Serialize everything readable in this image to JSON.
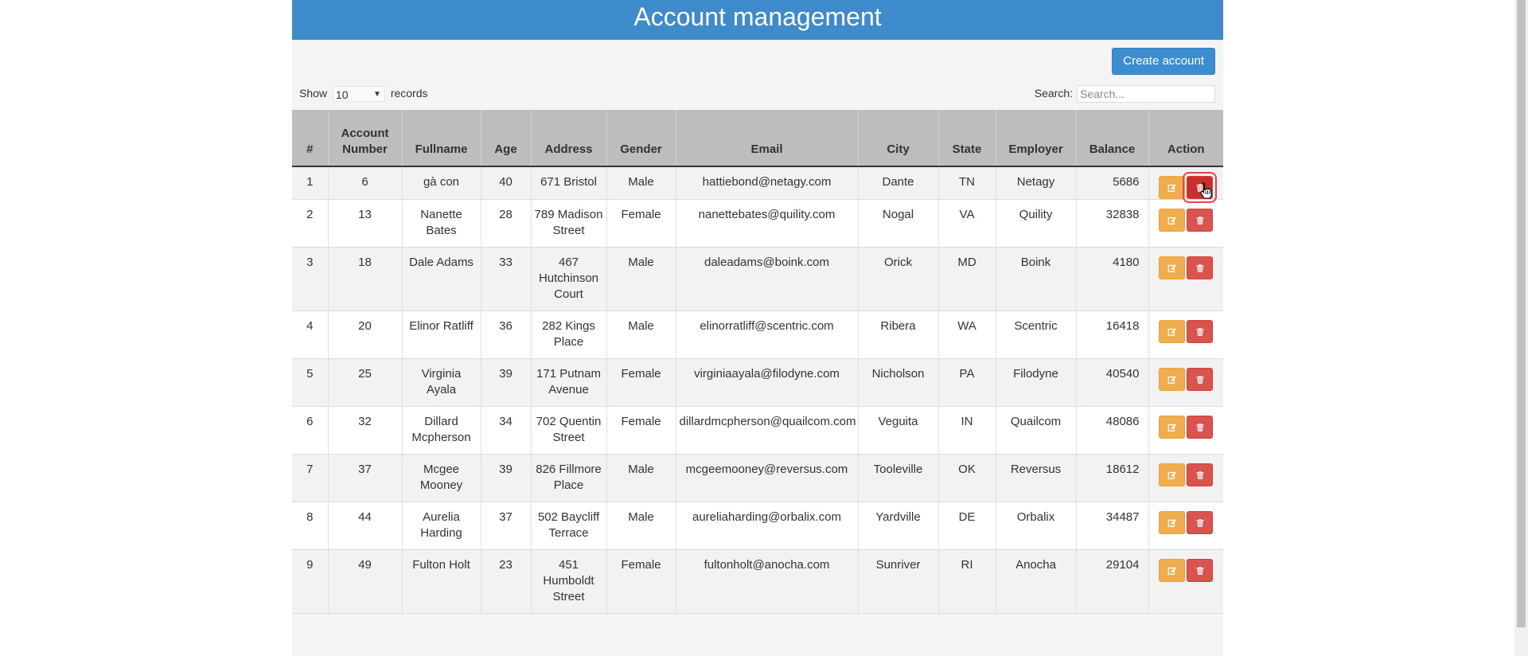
{
  "header": {
    "title": "Account management"
  },
  "toolbar": {
    "create_label": "Create account"
  },
  "controls": {
    "show_label": "Show",
    "records_label": "records",
    "page_size": "10",
    "search_label": "Search:",
    "search_placeholder": "Search..."
  },
  "table": {
    "columns": [
      "#",
      "Account Number",
      "Fullname",
      "Age",
      "Address",
      "Gender",
      "Email",
      "City",
      "State",
      "Employer",
      "Balance",
      "Action"
    ],
    "rows": [
      {
        "idx": "1",
        "acct": "6",
        "name": "gà con",
        "age": "40",
        "address": "671 Bristol",
        "gender": "Male",
        "email": "hattiebond@netagy.com",
        "city": "Dante",
        "state": "TN",
        "employer": "Netagy",
        "balance": "5686"
      },
      {
        "idx": "2",
        "acct": "13",
        "name": "Nanette Bates",
        "age": "28",
        "address": "789 Madison Street",
        "gender": "Female",
        "email": "nanettebates@quility.com",
        "city": "Nogal",
        "state": "VA",
        "employer": "Quility",
        "balance": "32838"
      },
      {
        "idx": "3",
        "acct": "18",
        "name": "Dale Adams",
        "age": "33",
        "address": "467 Hutchinson Court",
        "gender": "Male",
        "email": "daleadams@boink.com",
        "city": "Orick",
        "state": "MD",
        "employer": "Boink",
        "balance": "4180"
      },
      {
        "idx": "4",
        "acct": "20",
        "name": "Elinor Ratliff",
        "age": "36",
        "address": "282 Kings Place",
        "gender": "Male",
        "email": "elinorratliff@scentric.com",
        "city": "Ribera",
        "state": "WA",
        "employer": "Scentric",
        "balance": "16418"
      },
      {
        "idx": "5",
        "acct": "25",
        "name": "Virginia Ayala",
        "age": "39",
        "address": "171 Putnam Avenue",
        "gender": "Female",
        "email": "virginiaayala@filodyne.com",
        "city": "Nicholson",
        "state": "PA",
        "employer": "Filodyne",
        "balance": "40540"
      },
      {
        "idx": "6",
        "acct": "32",
        "name": "Dillard Mcpherson",
        "age": "34",
        "address": "702 Quentin Street",
        "gender": "Female",
        "email": "dillardmcpherson@quailcom.com",
        "city": "Veguita",
        "state": "IN",
        "employer": "Quailcom",
        "balance": "48086"
      },
      {
        "idx": "7",
        "acct": "37",
        "name": "Mcgee Mooney",
        "age": "39",
        "address": "826 Fillmore Place",
        "gender": "Male",
        "email": "mcgeemooney@reversus.com",
        "city": "Tooleville",
        "state": "OK",
        "employer": "Reversus",
        "balance": "18612"
      },
      {
        "idx": "8",
        "acct": "44",
        "name": "Aurelia Harding",
        "age": "37",
        "address": "502 Baycliff Terrace",
        "gender": "Male",
        "email": "aureliaharding@orbalix.com",
        "city": "Yardville",
        "state": "DE",
        "employer": "Orbalix",
        "balance": "34487"
      },
      {
        "idx": "9",
        "acct": "49",
        "name": "Fulton Holt",
        "age": "23",
        "address": "451 Humboldt Street",
        "gender": "Female",
        "email": "fultonholt@anocha.com",
        "city": "Sunriver",
        "state": "RI",
        "employer": "Anocha",
        "balance": "29104"
      }
    ]
  },
  "icons": {
    "edit": "edit-icon",
    "delete": "trash-icon"
  },
  "colors": {
    "header": "#3e8bcc",
    "primary": "#3c8dd0",
    "warning": "#f0ad4e",
    "danger": "#d9534f"
  }
}
